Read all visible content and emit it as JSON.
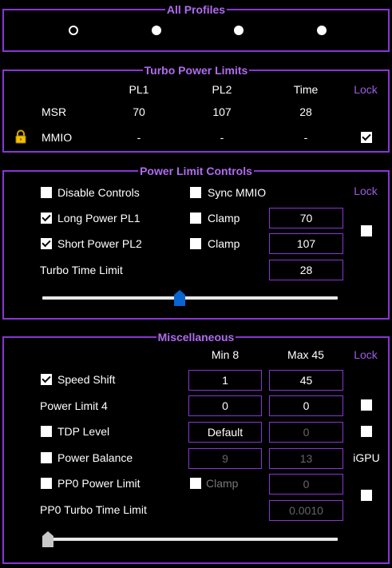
{
  "all_profiles": {
    "title": "All Profiles",
    "profiles": [
      {
        "selected": true
      },
      {
        "selected": false
      },
      {
        "selected": false
      },
      {
        "selected": false
      }
    ]
  },
  "turbo_power_limits": {
    "title": "Turbo Power Limits",
    "col_pl1": "PL1",
    "col_pl2": "PL2",
    "col_time": "Time",
    "col_lock": "Lock",
    "msr": {
      "label": "MSR",
      "pl1": "70",
      "pl2": "107",
      "time": "28"
    },
    "mmio": {
      "label": "MMIO",
      "pl1": "-",
      "pl2": "-",
      "time": "-",
      "locked": true
    },
    "lock_icon": "padlock-icon"
  },
  "power_limit_controls": {
    "title": "Power Limit Controls",
    "disable_controls": {
      "label": "Disable Controls",
      "checked": false
    },
    "sync_mmio": {
      "label": "Sync MMIO",
      "checked": false
    },
    "lock_label": "Lock",
    "long_power": {
      "label": "Long Power PL1",
      "checked": true,
      "clamp_label": "Clamp",
      "clamp": false,
      "value": "70"
    },
    "short_power": {
      "label": "Short Power PL2",
      "checked": true,
      "clamp_label": "Clamp",
      "clamp": false,
      "value": "107"
    },
    "lock_checked": false,
    "turbo_time": {
      "label": "Turbo Time Limit",
      "value": "28",
      "slider_fraction": 0.46
    }
  },
  "misc": {
    "title": "Miscellaneous",
    "min_header": "Min  8",
    "max_header": "Max  45",
    "lock_label": "Lock",
    "speed_shift": {
      "label": "Speed Shift",
      "checked": true,
      "min": "1",
      "max": "45"
    },
    "power_limit_4": {
      "label": "Power Limit 4",
      "min": "0",
      "max": "0",
      "lock": false
    },
    "tdp_level": {
      "label": "TDP Level",
      "checked": false,
      "min": "Default",
      "max": "0",
      "lock": false
    },
    "power_balance": {
      "label": "Power Balance",
      "checked": false,
      "min": "9",
      "max": "13",
      "igpu_label": "iGPU"
    },
    "pp0_power_limit": {
      "label": "PP0 Power Limit",
      "checked": false,
      "clamp_label": "Clamp",
      "clamp": false,
      "value": "0",
      "lock": false
    },
    "pp0_turbo_time": {
      "label": "PP0 Turbo Time Limit",
      "value": "0.0010",
      "slider_fraction": 0.0
    }
  },
  "colors": {
    "accent": "#8a35d6",
    "legend": "#b06bf0",
    "lock_text": "#9b5de5",
    "thumb_blue": "#0a64d2",
    "thumb_grey": "#c8c8c8"
  }
}
